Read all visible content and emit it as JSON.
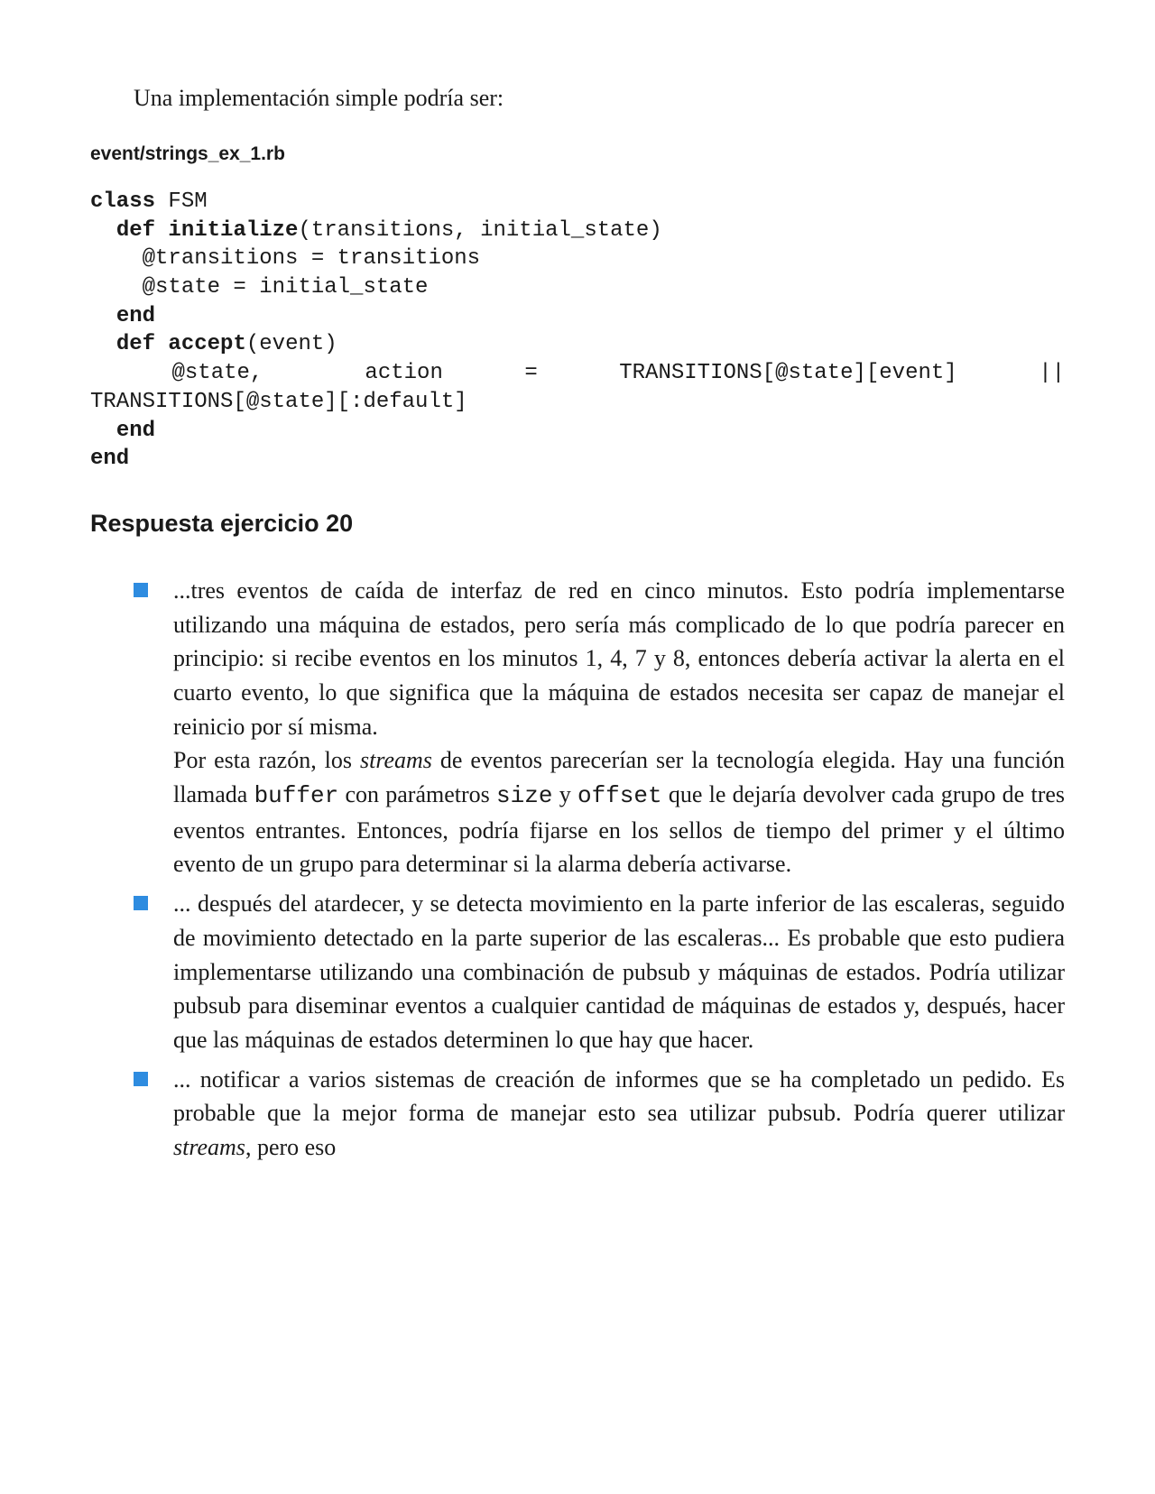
{
  "intro": "Una implementación simple podría ser:",
  "filename": "event/strings_ex_1.rb",
  "code": {
    "k_class": "class",
    "cls": " FSM",
    "k_def1": "def",
    "def1_rest": " initialize",
    "def1_args": "(transitions, initial_state)",
    "l3": "    @transitions = transitions",
    "l4": "    @state = initial_state",
    "k_end1": "end",
    "k_def2": "def",
    "def2_rest": " accept",
    "def2_args": "(event)",
    "l7_pre": "    @state,     action    =    TRANSITIONS[@state][event]    ||",
    "l8": "TRANSITIONS[@state][:default]",
    "k_end2": "end",
    "k_end3": "end"
  },
  "section_title": "Respuesta ejercicio 20",
  "bullets": {
    "b1_p1a": "...tres eventos de caída de interfaz de red en cinco minutos. Esto podría implementarse utilizando una máquina de estados, pero sería más complicado de lo que podría parecer en principio: si recibe eventos en los minutos 1, 4, 7 y 8, entonces debería activar la alerta en el cuarto evento, lo que significa que la máquina de estados necesita ser capaz de manejar el reinicio por sí misma.",
    "b1_p2a": "Por esta razón, los ",
    "b1_streams": "streams",
    "b1_p2b": " de eventos parecerían ser la tecnología elegida. Hay una función llamada ",
    "b1_buffer": "buffer",
    "b1_p2c": " con parámetros ",
    "b1_size": "size",
    "b1_p2d": " y ",
    "b1_offset": "offset",
    "b1_p2e": " que le dejaría devolver cada grupo de tres eventos entrantes. Entonces, podría fijarse en los sellos de tiempo del primer y el último evento de un grupo para determinar si la alarma debería activarse.",
    "b2": "... después del atardecer, y se detecta movimiento en la parte inferior de las escaleras, seguido de movimiento detectado en la parte superior de las escaleras... Es probable que esto pudiera implementarse utilizando una combinación de pubsub y máquinas de estados. Podría utilizar pubsub para diseminar eventos a cualquier cantidad de máquinas de estados y, después, hacer que las máquinas de estados determinen lo que hay que hacer.",
    "b3a": "... notificar a varios sistemas de creación de informes que se ha completado un pedido. Es probable que la mejor forma de manejar esto sea utilizar pubsub. Podría querer utilizar ",
    "b3_streams": "streams",
    "b3b": ", pero eso"
  }
}
